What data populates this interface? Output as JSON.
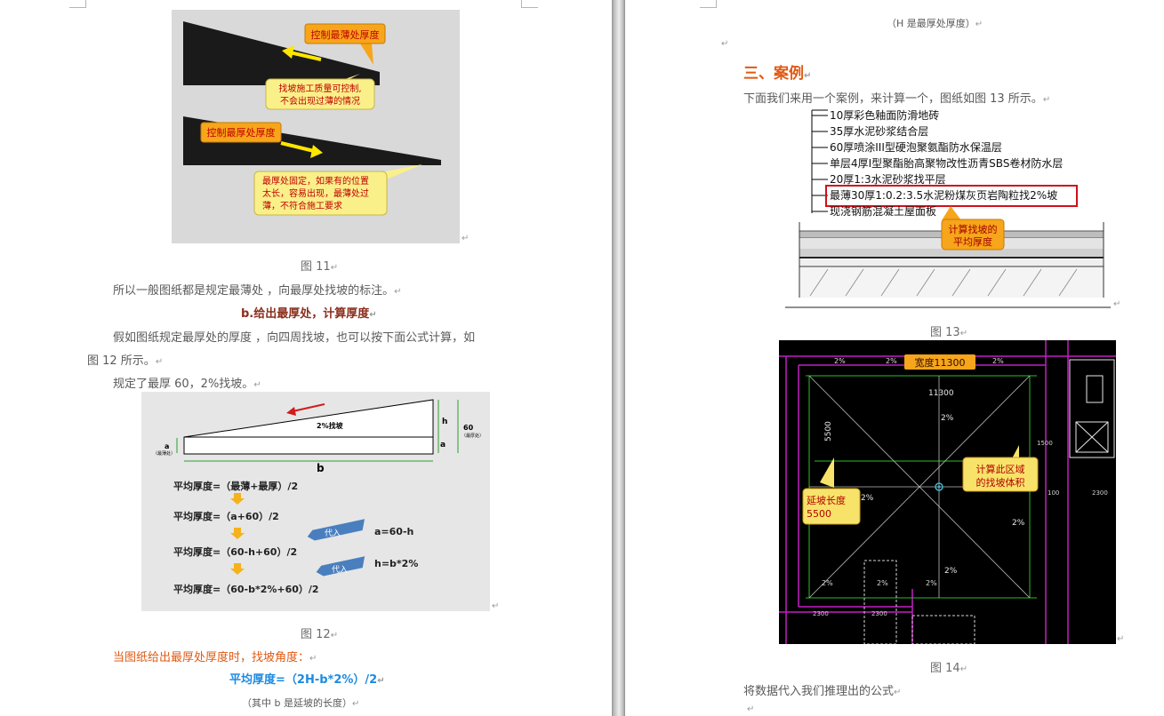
{
  "left": {
    "fig11": {
      "callout_thin": "控制最薄处厚度",
      "callout_ok_1": "找坡施工质量可控制,",
      "callout_ok_2": "不会出现过薄的情况",
      "callout_thick": "控制最厚处厚度",
      "callout_bad_1": "最厚处固定，如果有的位置",
      "callout_bad_2": "太长，容易出现，最薄处过",
      "callout_bad_3": "薄，不符合施工要求"
    },
    "caption11": "图 11",
    "para1": "所以一般图纸都是规定最薄处 ，向最厚处找坡的标注。",
    "heading_b": "b.给出最厚处，计算厚度",
    "para2_line1": "假如图纸规定最厚处的厚度 ，向四周找坡，也可以按下面公式计算，如",
    "para2_line2": "图 12 所示。",
    "para3": "规定了最厚 60，2%找坡。",
    "fig12": {
      "slope_label": "2%找坡",
      "h": "h",
      "a": "a",
      "a_note": "（最薄处）",
      "thick_value": "60",
      "thick_note": "（最厚处）",
      "b": "b",
      "f1": "平均厚度=（最薄+最厚）/2",
      "f2": "平均厚度=（a+60）/2",
      "f3": "平均厚度=（60-h+60）/2",
      "f4": "平均厚度=（60-b*2%+60）/2",
      "sub1_tag": "代入",
      "sub1_eq": "a=60-h",
      "sub2_tag": "代入",
      "sub2_eq": "h=b*2%"
    },
    "caption12": "图 12",
    "orange_line": "当图纸给出最厚处厚度时，找坡角度：",
    "formula": "平均厚度=（2H-b*2%）/2",
    "note_b": "（其中 b 是延坡的长度）"
  },
  "right": {
    "note_h": "（H 是最厚处厚度）",
    "heading3": "三、案例",
    "intro": "下面我们来用一个案例，来计算一个，图纸如图 13 所示。",
    "fig13": {
      "layers": [
        "10厚彩色釉面防滑地砖",
        "35厚水泥砂浆结合层",
        "60厚喷涂III型硬泡聚氨酯防水保温层",
        "单层4厚I型聚酯胎高聚物改性沥青SBS卷材防水层",
        "20厚1:3水泥砂浆找平层",
        "最薄30厚1:0.2:3.5水泥粉煤灰页岩陶粒找2%坡",
        "现浇钢筋混凝土屋面板"
      ],
      "callout_1": "计算找坡的",
      "callout_2": "平均厚度"
    },
    "caption13": "图 13",
    "fig14": {
      "width_callout": "宽度11300",
      "dim_top": "11300",
      "dim_left": "5500",
      "slope_1": "2%",
      "slope_2": "2%",
      "slope_3": "2%",
      "slope_top": "2%",
      "area_callout_1": "计算此区域",
      "area_callout_2": "的找坡体积",
      "len_callout_1": "延坡长度",
      "len_callout_2": "5500",
      "dim_2300a": "2300",
      "dim_2300b": "2300",
      "dim_2300c": "2300",
      "dim_100": "100",
      "dim_1500": "1500"
    },
    "caption14": "图 14",
    "last_line": "将数据代入我们推理出的公式"
  },
  "colors": {
    "orange_heading": "#e05a14",
    "callout_yellow": "#f7e36a",
    "callout_orange": "#f7a51a",
    "formula_blue": "#1e8be0",
    "cad_background": "#000000"
  }
}
